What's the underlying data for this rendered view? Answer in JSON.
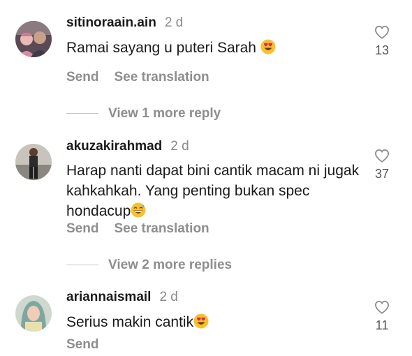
{
  "comments": [
    {
      "username": "sitinoraain.ain",
      "time": "2 d",
      "text": "Ramai sayang u puteri Sarah",
      "emoji": "heart-eyes",
      "likes": "13",
      "actions": [
        "Send",
        "See translation"
      ],
      "replies_label": "View 1 more reply"
    },
    {
      "username": "akuzakirahmad",
      "time": "2 d",
      "text": "Harap nanti dapat bini cantik macam ni jugak kahkahkah. Yang penting bukan spec hondacup",
      "emoji": "grinning-sweat",
      "likes": "37",
      "actions": [
        "Send",
        "See translation"
      ],
      "replies_label": "View 2 more replies"
    },
    {
      "username": "ariannaismail",
      "time": "2 d",
      "text": "Serius makin cantik",
      "emoji": "heart-eyes",
      "likes": "11",
      "actions": [
        "Send"
      ]
    }
  ],
  "icons": {
    "like": "heart-outline-icon"
  },
  "colors": {
    "secondary_text": "#8e8e8e",
    "primary_text": "#1a1a1a",
    "emoji_yellow": "#f7c12a",
    "emoji_heart": "#e0245e"
  }
}
